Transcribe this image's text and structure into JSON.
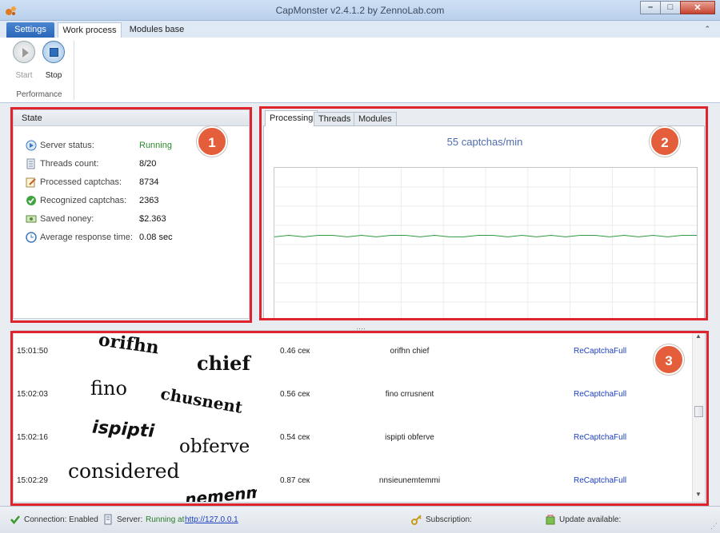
{
  "window": {
    "title": "CapMonster v2.4.1.2 by ZennoLab.com"
  },
  "ribbon": {
    "tabs": [
      "Settings",
      "Work process",
      "Modules base"
    ],
    "start_label": "Start",
    "stop_label": "Stop",
    "group_label": "Performance"
  },
  "state": {
    "header": "State",
    "rows": [
      {
        "label": "Server status:",
        "value": "Running"
      },
      {
        "label": "Threads count:",
        "value": "8/20"
      },
      {
        "label": "Processed captchas:",
        "value": "8734"
      },
      {
        "label": "Recognized captchas:",
        "value": "2363"
      },
      {
        "label": "Saved noney:",
        "value": "$2.363"
      },
      {
        "label": "Average response time:",
        "value": "0.08 sec"
      }
    ],
    "status_color": "#2a8a2a"
  },
  "chart": {
    "tabs": [
      "Processing",
      "Threads",
      "Modules"
    ],
    "rate": "55 captchas/min",
    "line_color": "#2e9a3e"
  },
  "chart_data": {
    "type": "line",
    "title": "55 captchas/min",
    "series": [
      {
        "values": [
          55,
          56,
          55,
          56,
          56,
          55,
          56,
          55,
          56,
          56,
          55,
          56,
          55,
          55,
          56,
          56,
          55,
          56,
          55,
          56,
          55,
          56,
          56,
          55,
          56,
          55,
          56,
          55,
          56,
          56
        ]
      }
    ],
    "ylim": [
      0,
      100
    ],
    "grid": true
  },
  "log": {
    "rows": [
      {
        "time": "15:01:50",
        "word1": "orifhn",
        "word2": "chief",
        "duration": "0.46 сек",
        "answer": "orifhn chief",
        "type": "ReCaptchaFull"
      },
      {
        "time": "15:02:03",
        "word1": "fino",
        "word2": "chusnent",
        "duration": "0.56 сек",
        "answer": "fino crrusnent",
        "type": "ReCaptchaFull"
      },
      {
        "time": "15:02:16",
        "word1": "ispipti",
        "word2": "obferve",
        "duration": "0.54 сек",
        "answer": "ispipti obferve",
        "type": "ReCaptchaFull"
      },
      {
        "time": "15:02:29",
        "word1": "considered",
        "word2": "nemenmi",
        "duration": "0.87 сек",
        "answer": "nnsieunemtemmi",
        "type": "ReCaptchaFull"
      }
    ]
  },
  "badges": [
    "1",
    "2",
    "3"
  ],
  "statusbar": {
    "connection": "Connection: Enabled",
    "server_label": "Server:",
    "server_status": "Running at",
    "server_url": "http://127.0.0.1",
    "subscription": "Subscription:",
    "update": "Update available:"
  },
  "highlight_color": "#e0242e",
  "badge_color": "#e45e3c"
}
